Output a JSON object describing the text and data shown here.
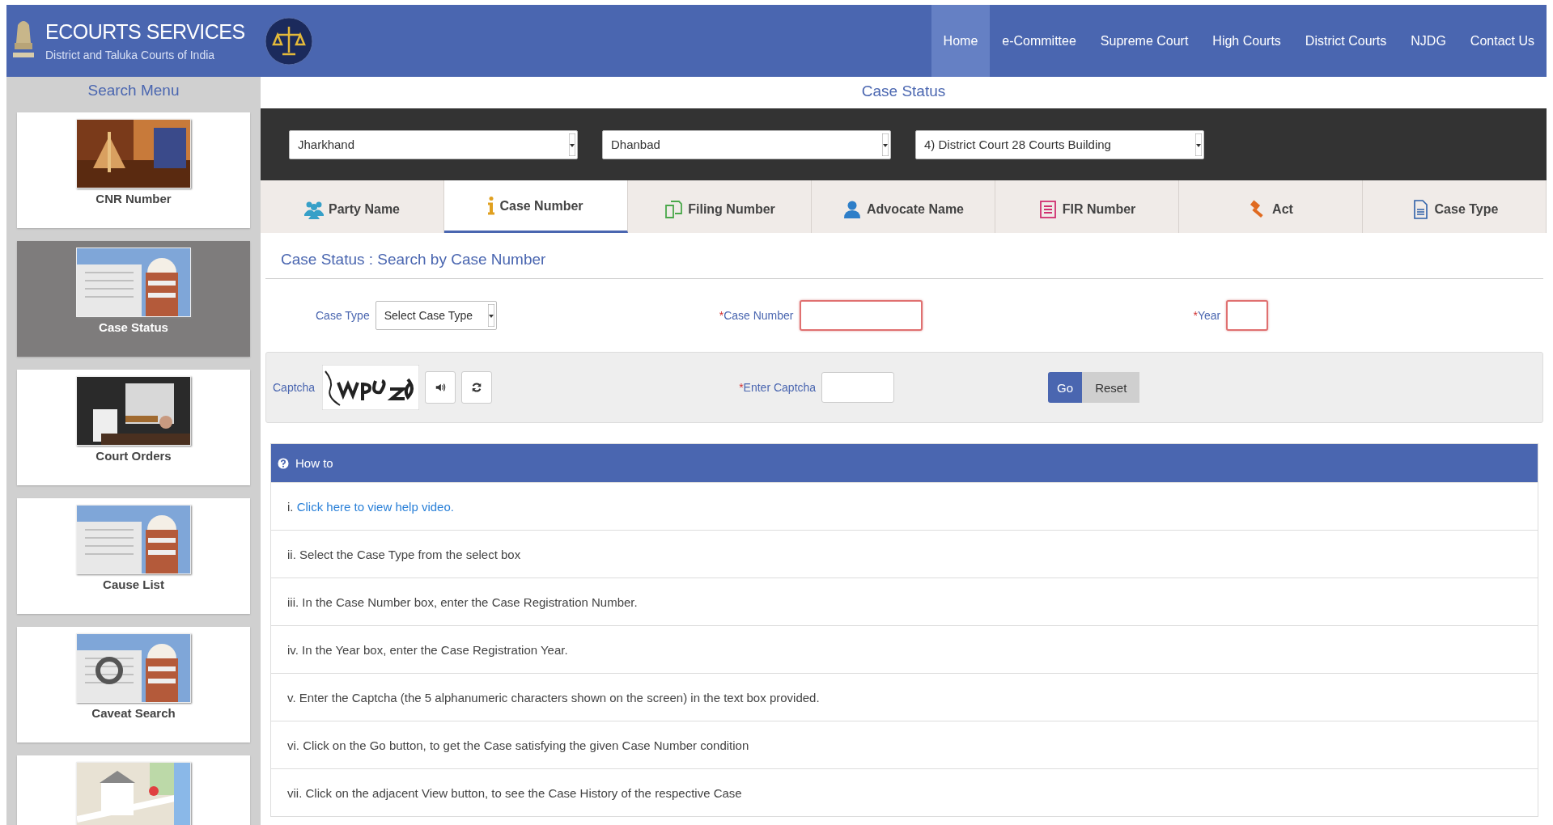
{
  "header": {
    "title": "ECOURTS SERVICES",
    "subtitle": "District and Taluka Courts of India"
  },
  "nav": [
    {
      "label": "Home",
      "selected": true
    },
    {
      "label": "e-Committee",
      "selected": false
    },
    {
      "label": "Supreme Court",
      "selected": false
    },
    {
      "label": "High Courts",
      "selected": false
    },
    {
      "label": "District Courts",
      "selected": false
    },
    {
      "label": "NJDG",
      "selected": false
    },
    {
      "label": "Contact Us",
      "selected": false
    }
  ],
  "sidebar": {
    "title": "Search Menu",
    "items": [
      {
        "label": "CNR Number",
        "selected": false
      },
      {
        "label": "Case Status",
        "selected": true
      },
      {
        "label": "Court Orders",
        "selected": false
      },
      {
        "label": "Cause List",
        "selected": false
      },
      {
        "label": "Caveat Search",
        "selected": false
      },
      {
        "selected": false
      }
    ]
  },
  "page_title": "Case Status",
  "selectors": [
    {
      "value": "Jharkhand"
    },
    {
      "value": "Dhanbad"
    },
    {
      "value": "4) District Court 28 Courts Building"
    }
  ],
  "tabs": [
    {
      "label": "Party Name",
      "selected": false
    },
    {
      "label": "Case Number",
      "selected": true
    },
    {
      "label": "Filing Number",
      "selected": false
    },
    {
      "label": "Advocate Name",
      "selected": false
    },
    {
      "label": "FIR Number",
      "selected": false
    },
    {
      "label": "Act",
      "selected": false
    },
    {
      "label": "Case Type",
      "selected": false
    }
  ],
  "form": {
    "heading": "Case Status : Search by Case Number",
    "case_type": {
      "label": "Case Type",
      "value": "Select Case Type"
    },
    "case_number": {
      "mark": "*",
      "label": "Case Number",
      "invalid": true
    },
    "year": {
      "mark": "*",
      "label": "Year",
      "invalid": true
    },
    "captcha": {
      "label": "Captcha"
    },
    "enter_captcha": {
      "mark": "*",
      "label": "Enter Captcha",
      "invalid": false
    },
    "buttons": [
      "Go",
      "Reset"
    ]
  },
  "howto": {
    "title": "How to",
    "items": [
      {
        "text": "i.",
        "link": "Click here to view help video."
      },
      {
        "text": "ii. Select the Case Type from the select box"
      },
      {
        "text": "iii. In the Case Number box, enter the Case Registration Number."
      },
      {
        "text": "iv. In the Year box, enter the Case Registration Year."
      },
      {
        "text": "v. Enter the Captcha (the 5 alphanumeric characters shown on the screen) in the text box provided."
      },
      {
        "text": "vi. Click on the Go button, to get the Case satisfying the given Case Number condition"
      },
      {
        "text": "vii. Click on the adjacent View button, to see the Case History of the respective Case"
      }
    ]
  }
}
